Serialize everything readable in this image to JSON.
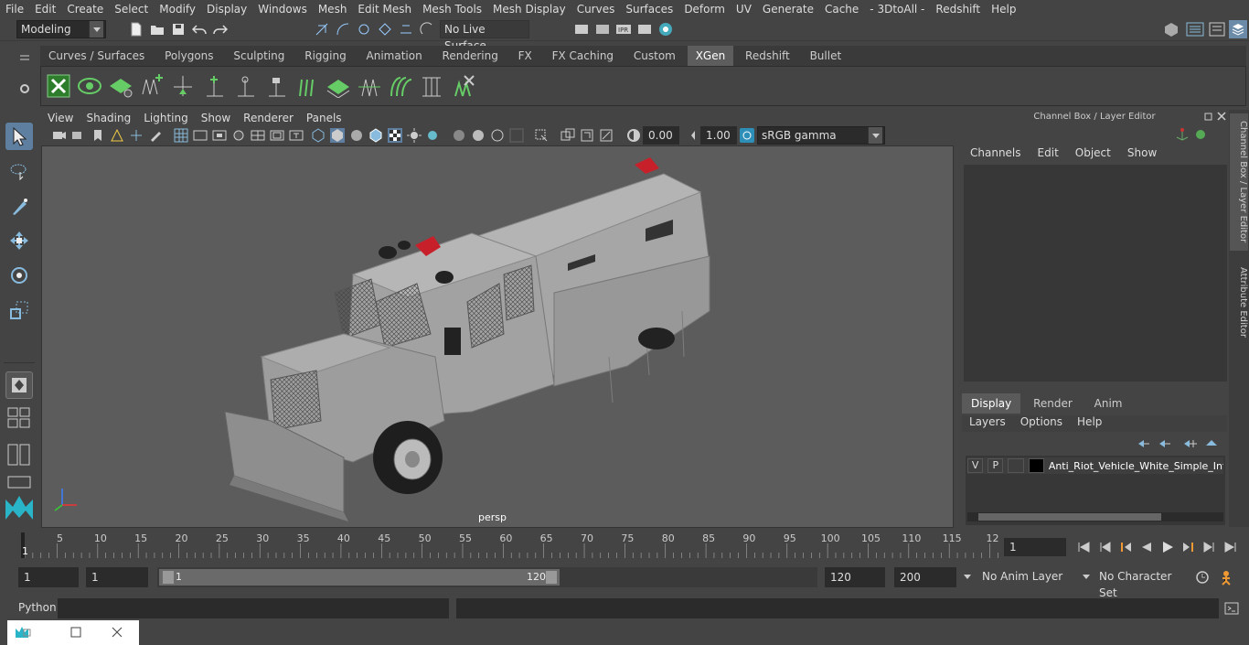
{
  "menubar": [
    "File",
    "Edit",
    "Create",
    "Select",
    "Modify",
    "Display",
    "Windows",
    "Mesh",
    "Edit Mesh",
    "Mesh Tools",
    "Mesh Display",
    "Curves",
    "Surfaces",
    "Deform",
    "UV",
    "Generate",
    "Cache",
    "- 3DtoAll -",
    "Redshift",
    "Help"
  ],
  "status": {
    "mode": "Modeling",
    "live_surface": "No Live Surface"
  },
  "shelf_tabs": [
    "Curves / Surfaces",
    "Polygons",
    "Sculpting",
    "Rigging",
    "Animation",
    "Rendering",
    "FX",
    "FX Caching",
    "Custom",
    "XGen",
    "Redshift",
    "Bullet"
  ],
  "shelf_active": "XGen",
  "viewport": {
    "menus": [
      "View",
      "Shading",
      "Lighting",
      "Show",
      "Renderer",
      "Panels"
    ],
    "exposure": "0.00",
    "gamma": "1.00",
    "color_space": "sRGB gamma",
    "camera_label": "persp"
  },
  "channel_box": {
    "title": "Channel Box / Layer Editor",
    "menus": [
      "Channels",
      "Edit",
      "Object",
      "Show"
    ]
  },
  "layer_editor": {
    "tabs": [
      "Display",
      "Render",
      "Anim"
    ],
    "active_tab": "Display",
    "menus": [
      "Layers",
      "Options",
      "Help"
    ],
    "layer": {
      "v": "V",
      "p": "P",
      "name": "Anti_Riot_Vehicle_White_Simple_Inte"
    }
  },
  "side_tabs": [
    "Channel Box / Layer Editor",
    "Attribute Editor"
  ],
  "timeline": {
    "ticks": [
      "5",
      "10",
      "15",
      "20",
      "25",
      "30",
      "35",
      "40",
      "45",
      "50",
      "55",
      "60",
      "65",
      "70",
      "75",
      "80",
      "85",
      "90",
      "95",
      "100",
      "105",
      "110",
      "115",
      "12"
    ],
    "start_label": "1",
    "current_frame": "1"
  },
  "range": {
    "start": "1",
    "playback_start": "1",
    "slider_start": "1",
    "slider_end": "120",
    "playback_end": "120",
    "end": "200",
    "anim_layer": "No Anim Layer",
    "character_set": "No Character Set"
  },
  "cmdline": {
    "label": "Python"
  }
}
